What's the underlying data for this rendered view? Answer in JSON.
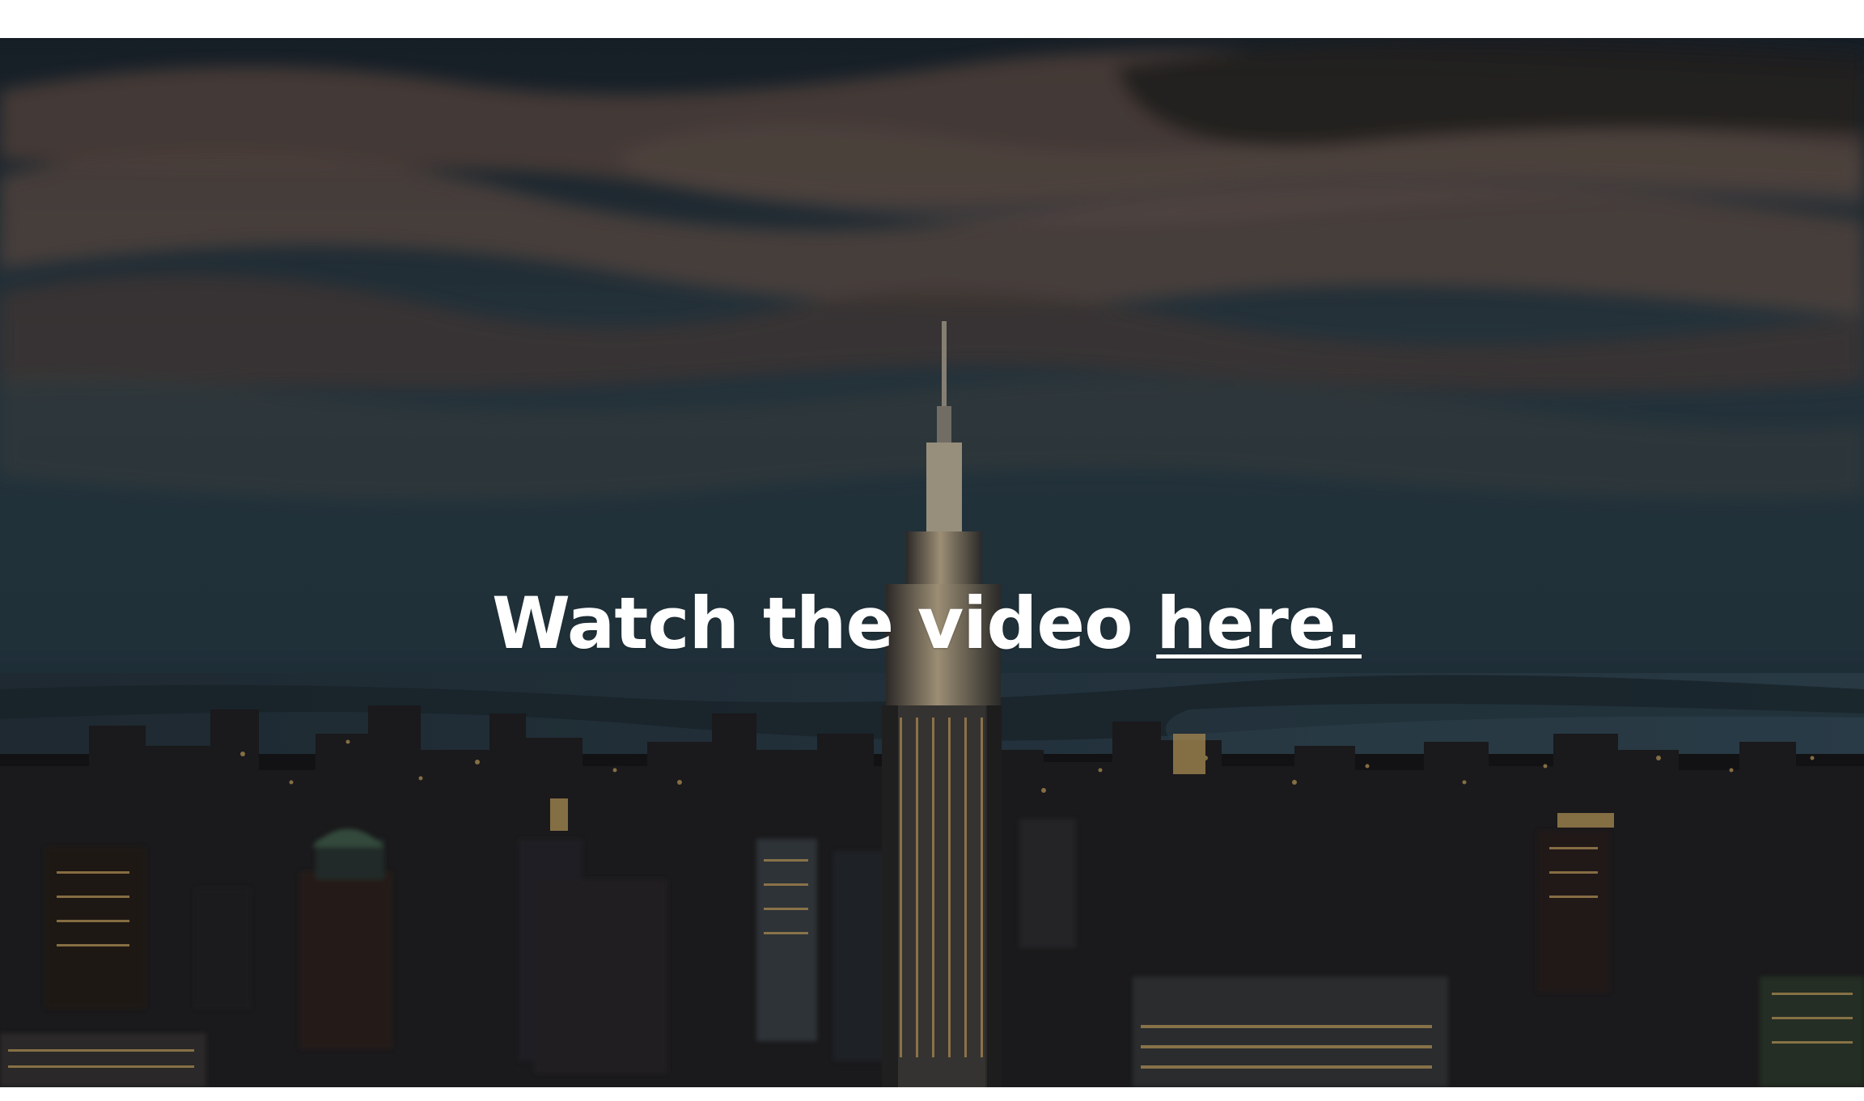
{
  "hero": {
    "headline": "Watch the video ",
    "link_text": "here."
  },
  "colors": {
    "sky_top": "#23333f",
    "sky_mid": "#2c4350",
    "cloud": "#6d5a54",
    "water": "#2e4452",
    "city_dark": "#1a1b1f",
    "window_light": "#d9b36c",
    "text": "#ffffff"
  },
  "icons": {
    "background": "city-skyline-photo-icon"
  }
}
